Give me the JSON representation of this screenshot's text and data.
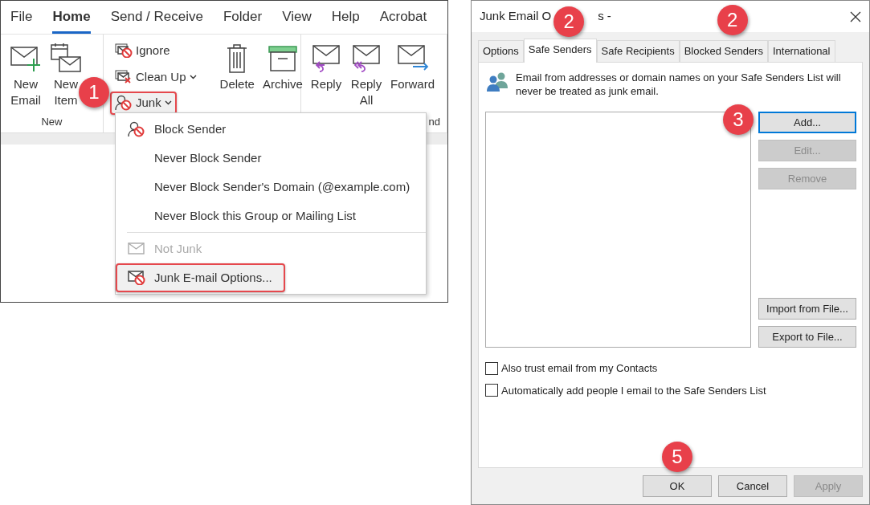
{
  "ribbon_tabs": [
    {
      "label": "File",
      "selected": false
    },
    {
      "label": "Home",
      "selected": true
    },
    {
      "label": "Send / Receive",
      "selected": false
    },
    {
      "label": "Folder",
      "selected": false
    },
    {
      "label": "View",
      "selected": false
    },
    {
      "label": "Help",
      "selected": false
    },
    {
      "label": "Acrobat",
      "selected": false
    }
  ],
  "ribbon_groups": [
    {
      "label": "New",
      "large": [
        {
          "kind": "new-email",
          "label": "New Email"
        },
        {
          "kind": "new-items",
          "label": "New Item"
        }
      ]
    },
    {
      "small": [
        {
          "kind": "ignore",
          "label": "Ignore",
          "dropdown": false,
          "highlighted": false
        },
        {
          "kind": "cleanup",
          "label": "Clean Up",
          "dropdown": true,
          "highlighted": false
        },
        {
          "kind": "junk",
          "label": "Junk",
          "dropdown": true,
          "highlighted": true,
          "callout": "1"
        }
      ],
      "large": [
        {
          "kind": "delete",
          "label": "Delete"
        },
        {
          "kind": "archive",
          "label": "Archive"
        }
      ]
    },
    {
      "label": "nd",
      "large": [
        {
          "kind": "reply",
          "label": "Reply"
        },
        {
          "kind": "reply-all",
          "label": "Reply All"
        },
        {
          "kind": "forward",
          "label": "Forward"
        }
      ]
    }
  ],
  "junk_menu": [
    {
      "kind": "block",
      "label": "Block Sender",
      "disabled": false,
      "highlighted": false
    },
    {
      "kind": "plain",
      "label": "Never Block Sender",
      "disabled": false,
      "highlighted": false
    },
    {
      "kind": "plain",
      "label": "Never Block Sender's Domain (@example.com)",
      "disabled": false,
      "highlighted": false
    },
    {
      "kind": "plain",
      "label": "Never Block this Group or Mailing List",
      "disabled": false,
      "highlighted": false
    },
    {
      "kind": "separator"
    },
    {
      "kind": "mail",
      "label": "Not Junk",
      "disabled": true,
      "highlighted": false
    },
    {
      "kind": "options",
      "label": "Junk E-mail Options...",
      "disabled": false,
      "highlighted": true
    }
  ],
  "dialog": {
    "title": "Junk Email O",
    "title_tail": "s -",
    "tabs": [
      {
        "label": "Options",
        "selected": false
      },
      {
        "label": "Safe Senders",
        "selected": true,
        "callout": "2"
      },
      {
        "label": "Safe Recipients",
        "selected": false
      },
      {
        "label": "Blocked Senders",
        "selected": false,
        "callout": "2"
      },
      {
        "label": "International",
        "selected": false
      }
    ],
    "description": "Email from addresses or domain names on your Safe Senders List will never be treated as junk email.",
    "side_buttons": [
      {
        "label": "Add...",
        "disabled": false,
        "focused": true,
        "callout": "3"
      },
      {
        "label": "Edit...",
        "disabled": true,
        "focused": false
      },
      {
        "label": "Remove",
        "disabled": true,
        "focused": false
      },
      {
        "kind": "gap"
      },
      {
        "label": "Import from File...",
        "disabled": false,
        "focused": false
      },
      {
        "label": "Export to File...",
        "disabled": false,
        "focused": false
      }
    ],
    "checkboxes": [
      {
        "label": "Also trust email from my Contacts",
        "checked": false
      },
      {
        "label": "Automatically add people I email to the Safe Senders List",
        "checked": false
      }
    ],
    "footer_buttons": [
      {
        "label": "OK",
        "disabled": false,
        "callout": "5"
      },
      {
        "label": "Cancel",
        "disabled": false
      },
      {
        "label": "Apply",
        "disabled": true
      }
    ]
  }
}
